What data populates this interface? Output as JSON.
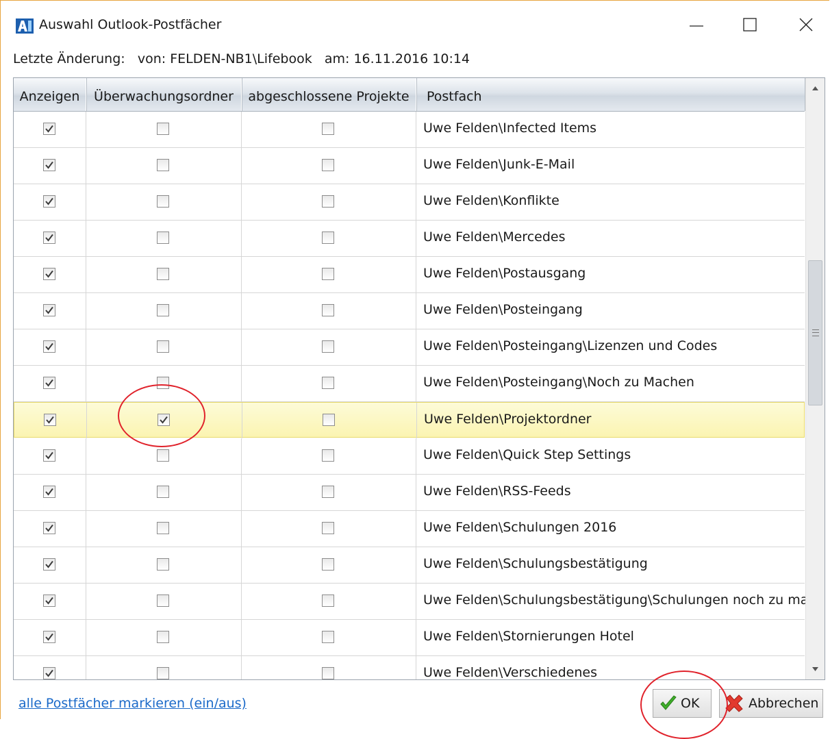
{
  "window": {
    "title": "Auswahl Outlook-Postfächer",
    "app_icon": "app-logo-icon",
    "controls": [
      "minimize-icon",
      "maximize-icon",
      "close-icon"
    ]
  },
  "info": {
    "last_change_label": "Letzte Änderung:",
    "by_label": "von:",
    "by_value": "FELDEN-NB1\\Lifebook",
    "at_label": "am:",
    "at_value": "16.11.2016 10:14"
  },
  "table": {
    "columns": [
      "Anzeigen",
      "Überwachungsordner",
      "abgeschlossene Projekte",
      "Postfach"
    ],
    "rows": [
      {
        "show": true,
        "monitor": false,
        "closed": false,
        "path": "Uwe Felden\\Infected Items"
      },
      {
        "show": true,
        "monitor": false,
        "closed": false,
        "path": "Uwe Felden\\Junk-E-Mail"
      },
      {
        "show": true,
        "monitor": false,
        "closed": false,
        "path": "Uwe Felden\\Konflikte"
      },
      {
        "show": true,
        "monitor": false,
        "closed": false,
        "path": "Uwe Felden\\Mercedes"
      },
      {
        "show": true,
        "monitor": false,
        "closed": false,
        "path": "Uwe Felden\\Postausgang"
      },
      {
        "show": true,
        "monitor": false,
        "closed": false,
        "path": "Uwe Felden\\Posteingang"
      },
      {
        "show": true,
        "monitor": false,
        "closed": false,
        "path": "Uwe Felden\\Posteingang\\Lizenzen und Codes"
      },
      {
        "show": true,
        "monitor": false,
        "closed": false,
        "path": "Uwe Felden\\Posteingang\\Noch zu Machen"
      },
      {
        "show": true,
        "monitor": true,
        "closed": false,
        "path": "Uwe Felden\\Projektordner",
        "selected": true
      },
      {
        "show": true,
        "monitor": false,
        "closed": false,
        "path": "Uwe Felden\\Quick Step Settings"
      },
      {
        "show": true,
        "monitor": false,
        "closed": false,
        "path": "Uwe Felden\\RSS-Feeds"
      },
      {
        "show": true,
        "monitor": false,
        "closed": false,
        "path": "Uwe Felden\\Schulungen 2016"
      },
      {
        "show": true,
        "monitor": false,
        "closed": false,
        "path": "Uwe Felden\\Schulungsbestätigung"
      },
      {
        "show": true,
        "monitor": false,
        "closed": false,
        "path": "Uwe Felden\\Schulungsbestätigung\\Schulungen noch zu ma"
      },
      {
        "show": true,
        "monitor": false,
        "closed": false,
        "path": "Uwe Felden\\Stornierungen Hotel"
      },
      {
        "show": true,
        "monitor": false,
        "closed": false,
        "path": "Uwe Felden\\Verschiedenes"
      }
    ]
  },
  "footer": {
    "toggle_all_link": "alle Postfächer markieren (ein/aus)",
    "ok_label": "OK",
    "ok_icon": "green-checkmark-icon",
    "cancel_label": "Abbrechen",
    "cancel_icon": "red-x-icon"
  },
  "colors": {
    "annotation": "#e0222b",
    "selected_row": "#fbf4b1",
    "link": "#1b6ac9"
  }
}
